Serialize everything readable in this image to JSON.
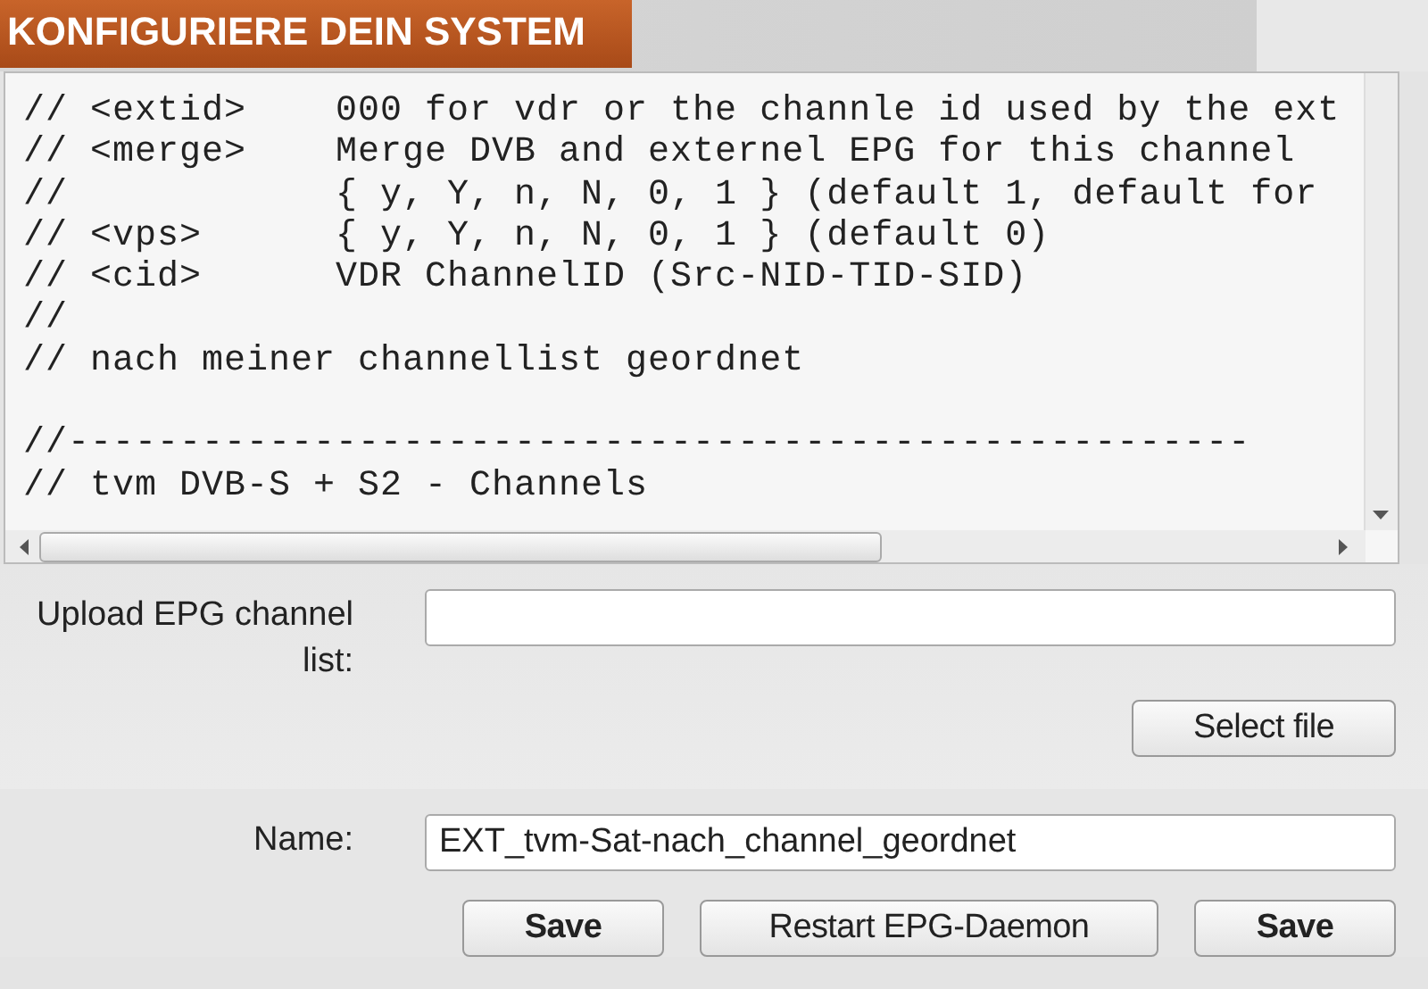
{
  "header": {
    "title": "KONFIGURIERE DEIN SYSTEM"
  },
  "editor": {
    "blocks": [
      {
        "lines": [
          "// <extid>    000 for vdr or the channle id used by the ext",
          "// <merge>    Merge DVB and externel EPG for this channel",
          "//            { y, Y, n, N, 0, 1 } (default 1, default for",
          "// <vps>      { y, Y, n, N, 0, 1 } (default 0)",
          "// <cid>      VDR ChannelID (Src-NID-TID-SID)",
          "//",
          "// nach meiner channellist geordnet"
        ]
      },
      {
        "lines": [
          "//-----------------------------------------------------",
          "// tvm DVB-S + S2 - Channels"
        ]
      }
    ]
  },
  "upload": {
    "label": "Upload EPG channel list:",
    "button": "Select file"
  },
  "name": {
    "label": "Name:",
    "value": "EXT_tvm-Sat-nach_channel_geordnet"
  },
  "buttons": [
    "Save",
    "Restart EPG-Daemon",
    "Save"
  ]
}
